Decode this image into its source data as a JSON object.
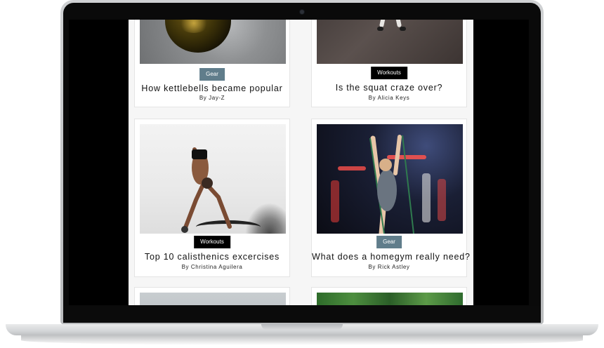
{
  "articles": [
    {
      "category": "Gear",
      "category_color": "#607d8b",
      "title": "How kettlebells became popular",
      "author": "By Jay-Z"
    },
    {
      "category": "Workouts",
      "category_color": "#000000",
      "title": "Is the squat craze over?",
      "author": "By Alicia Keys"
    },
    {
      "category": "Workouts",
      "category_color": "#000000",
      "title": "Top 10 calisthenics excercises",
      "author": "By Christina Aguilera"
    },
    {
      "category": "Gear",
      "category_color": "#607d8b",
      "title": "What does a homegym really need?",
      "author": "By Rick Astley"
    }
  ],
  "images": {
    "a1": "kettlebell-photo",
    "a2": "squat-photo",
    "a3": "calisthenics-photo",
    "a4": "homegym-photo",
    "a5": "partial-photo",
    "a6": "greens-photo"
  }
}
